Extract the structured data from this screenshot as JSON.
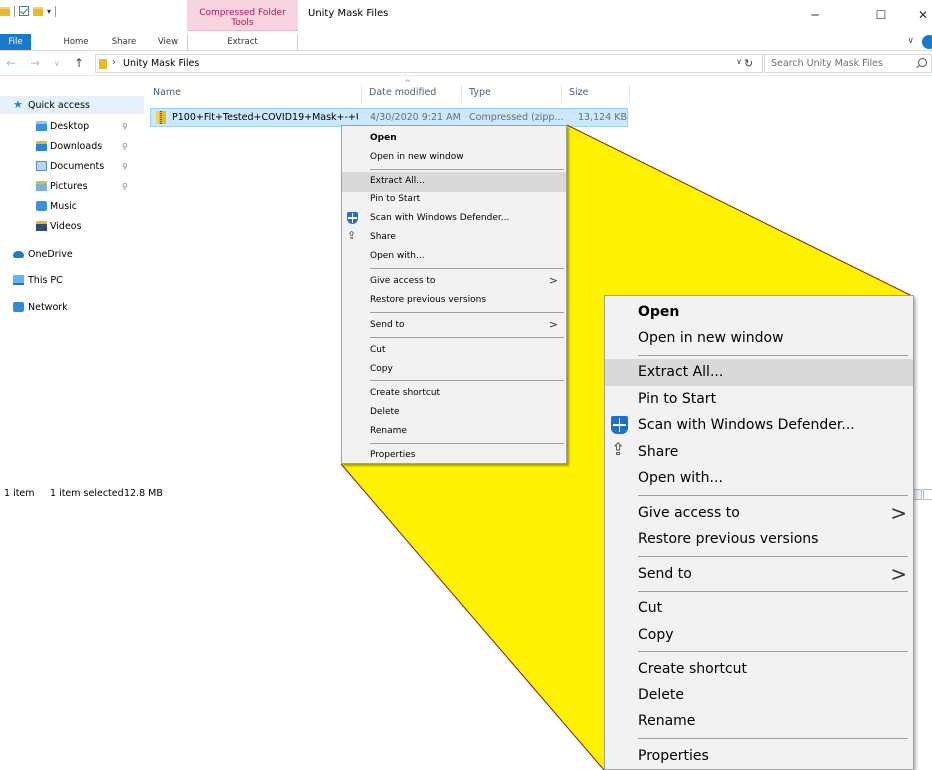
{
  "colors": {
    "callout_fill": "#fff200",
    "callout_stroke": "#8b1a1a",
    "accent": "#1979ca",
    "selection": "#cce8ff",
    "context_tab": "#f8d3e0"
  },
  "titlebar": {
    "context_tab_group": "Compressed Folder Tools",
    "title": "Unity Mask Files",
    "minimize": "─",
    "maximize": "☐",
    "close": "✕"
  },
  "ribbon": {
    "tabs": [
      "File",
      "Home",
      "Share",
      "View",
      "Extract"
    ],
    "collapse": "∨"
  },
  "address": {
    "back": "←",
    "forward": "→",
    "recent": "∨",
    "up": "↑",
    "chevron": "›",
    "path": "Unity Mask Files",
    "dropdown": "∨",
    "refresh": "↻"
  },
  "search": {
    "placeholder": "Search Unity Mask Files"
  },
  "nav": {
    "quick_access": "Quick access",
    "pin": "⚲",
    "items": [
      {
        "label": "Desktop",
        "icon": "desktop-folder-icon",
        "pinned": true
      },
      {
        "label": "Downloads",
        "icon": "downloads-folder-icon",
        "pinned": true
      },
      {
        "label": "Documents",
        "icon": "documents-folder-icon",
        "pinned": true
      },
      {
        "label": "Pictures",
        "icon": "pictures-folder-icon",
        "pinned": true
      },
      {
        "label": "Music",
        "icon": "music-folder-icon",
        "pinned": false
      },
      {
        "label": "Videos",
        "icon": "videos-folder-icon",
        "pinned": false
      }
    ],
    "onedrive": "OneDrive",
    "this_pc": "This PC",
    "network": "Network"
  },
  "file_list": {
    "columns": [
      "Name",
      "Date modified",
      "Type",
      "Size"
    ],
    "sort_indicator": "^",
    "rows": [
      {
        "name": "P100+Fit+Tested+COVID19+Mask+-+Uni...",
        "date": "4/30/2020 9:21 AM",
        "type": "Compressed (zipp...",
        "size": "13,124 KB"
      }
    ]
  },
  "status": {
    "count": "1 item",
    "selected": "1 item selected",
    "size": "12.8 MB"
  },
  "context_menu": {
    "items": [
      {
        "label": "Open",
        "bold": true
      },
      {
        "label": "Open in new window"
      },
      {
        "label": "Extract All...",
        "highlighted": true
      },
      {
        "label": "Pin to Start"
      },
      {
        "label": "Scan with Windows Defender...",
        "icon": "windows-defender-icon"
      },
      {
        "label": "Share",
        "icon": "share-icon"
      },
      {
        "label": "Open with..."
      },
      {
        "label": "Give access to",
        "submenu": true
      },
      {
        "label": "Restore previous versions"
      },
      {
        "label": "Send to",
        "submenu": true
      },
      {
        "label": "Cut"
      },
      {
        "label": "Copy"
      },
      {
        "label": "Create shortcut"
      },
      {
        "label": "Delete"
      },
      {
        "label": "Rename"
      },
      {
        "label": "Properties"
      }
    ],
    "submenu_arrow": ">"
  }
}
